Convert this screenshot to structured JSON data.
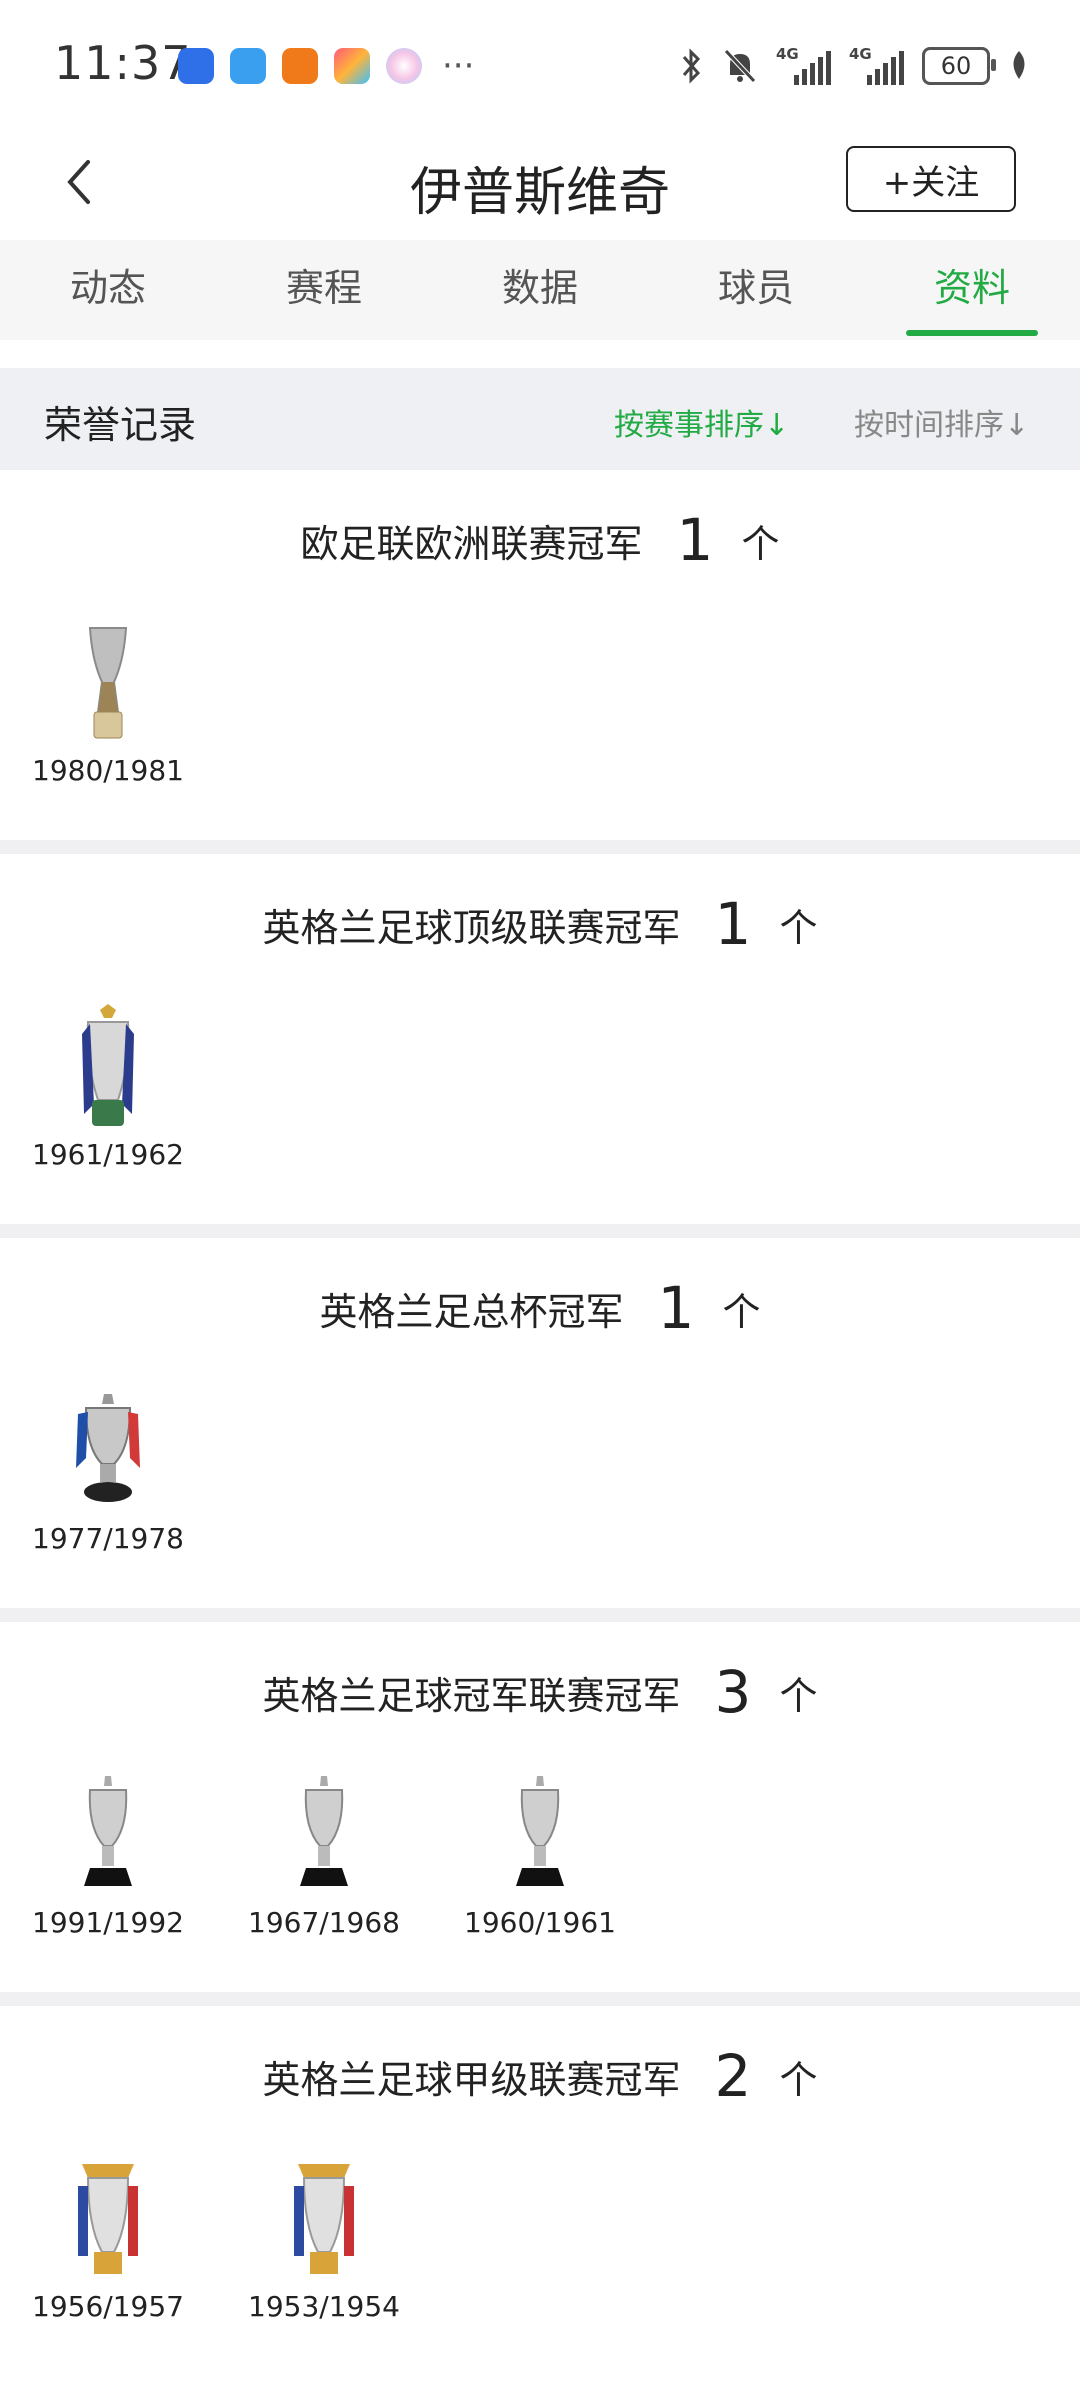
{
  "status_bar": {
    "time": "11:37",
    "battery": "60",
    "network1": "4G",
    "network2": "4G",
    "more": "···"
  },
  "header": {
    "title": "伊普斯维奇",
    "follow_label": "+关注"
  },
  "tabs": [
    {
      "label": "动态"
    },
    {
      "label": "赛程"
    },
    {
      "label": "数据"
    },
    {
      "label": "球员"
    },
    {
      "label": "资料",
      "active": true
    }
  ],
  "honors": {
    "title": "荣誉记录",
    "sort_by_competition": "按赛事排序↓",
    "sort_by_time": "按时间排序↓"
  },
  "sections": [
    {
      "name": "欧足联欧洲联赛冠军",
      "count": "1",
      "unit": "个",
      "trophies": [
        {
          "year": "1980/1981"
        }
      ]
    },
    {
      "name": "英格兰足球顶级联赛冠军",
      "count": "1",
      "unit": "个",
      "trophies": [
        {
          "year": "1961/1962"
        }
      ]
    },
    {
      "name": "英格兰足总杯冠军",
      "count": "1",
      "unit": "个",
      "trophies": [
        {
          "year": "1977/1978"
        }
      ]
    },
    {
      "name": "英格兰足球冠军联赛冠军",
      "count": "3",
      "unit": "个",
      "trophies": [
        {
          "year": "1991/1992"
        },
        {
          "year": "1967/1968"
        },
        {
          "year": "1960/1961"
        }
      ]
    },
    {
      "name": "英格兰足球甲级联赛冠军",
      "count": "2",
      "unit": "个",
      "trophies": [
        {
          "year": "1956/1957"
        },
        {
          "year": "1953/1954"
        }
      ]
    }
  ],
  "colors": {
    "accent": "#22aa44",
    "text": "#222222",
    "muted": "#888888",
    "bar_bg": "#eef0f3"
  }
}
